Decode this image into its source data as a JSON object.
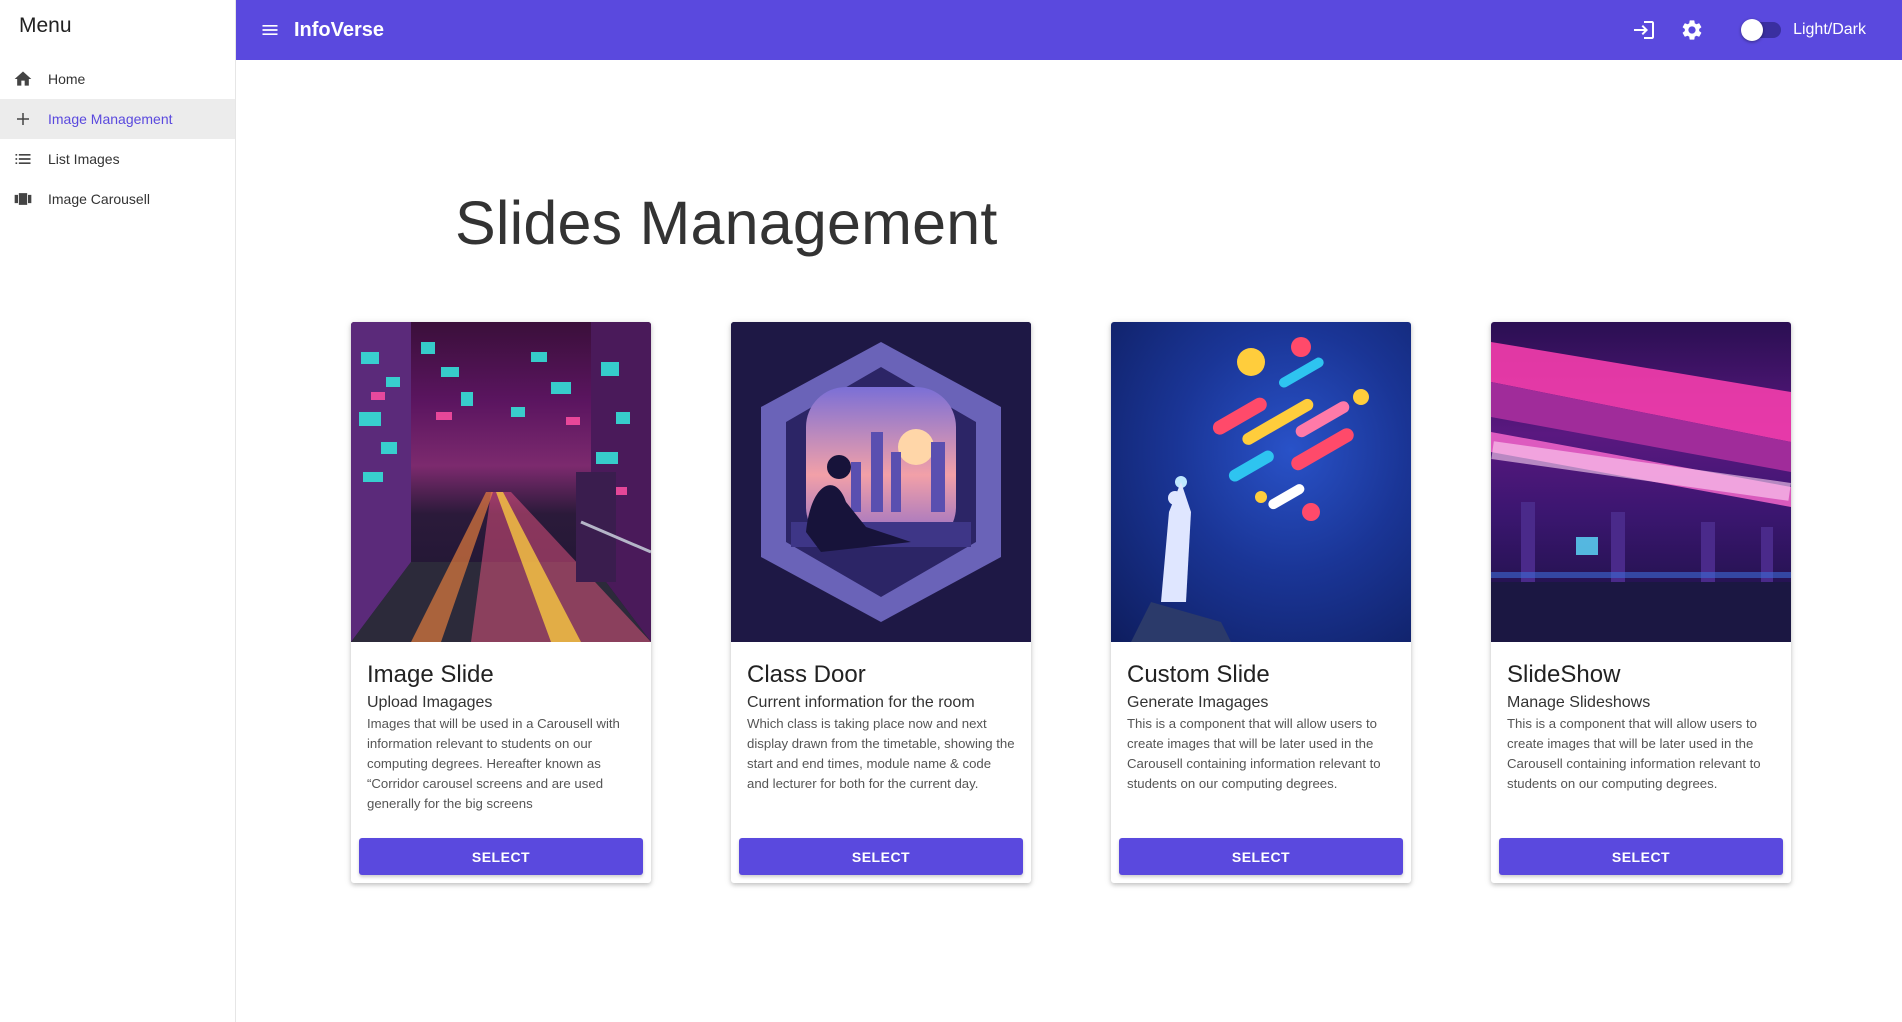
{
  "sidebar": {
    "title": "Menu",
    "items": [
      {
        "label": "Home",
        "icon": "home-icon",
        "active": false
      },
      {
        "label": "Image Management",
        "icon": "plus-icon",
        "active": true
      },
      {
        "label": "List Images",
        "icon": "list-icon",
        "active": false
      },
      {
        "label": "Image Carousell",
        "icon": "carousel-icon",
        "active": false
      }
    ]
  },
  "topbar": {
    "brand": "InfoVerse",
    "toggle_label": "Light/Dark",
    "accent_color": "#5a49de"
  },
  "main": {
    "title": "Slides Management",
    "cards": [
      {
        "title": "Image Slide",
        "subtitle": "Upload Imagages",
        "description": "Images that will be used in a Carousell with information relevant to students on our computing degrees. Hereafter known as “Corridor carousel screens and are used generally for the big screens",
        "button": "SELECT"
      },
      {
        "title": "Class Door",
        "subtitle": "Current information for the room",
        "description": "Which class is taking place now and next display drawn from the timetable, showing the start and end times, module name & code and lecturer for both for the current day.",
        "button": "SELECT"
      },
      {
        "title": "Custom Slide",
        "subtitle": "Generate Imagages",
        "description": "This is a component that will allow users to create images that will be later used in the Carousell containing information relevant to students on our computing degrees.",
        "button": "SELECT"
      },
      {
        "title": "SlideShow",
        "subtitle": "Manage Slideshows",
        "description": "This is a component that will allow users to create images that will be later used in the Carousell containing information relevant to students on our computing degrees.",
        "button": "SELECT"
      }
    ]
  }
}
